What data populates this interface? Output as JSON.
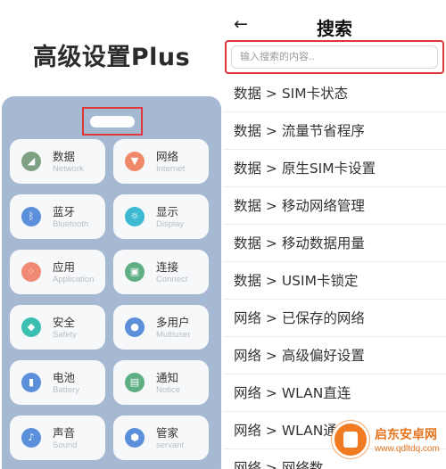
{
  "left": {
    "title": "高级设置Plus",
    "tiles": [
      {
        "name": "数据",
        "sub": "Network",
        "icon": "signal-icon",
        "glyph": "◢",
        "color": "#7ea183"
      },
      {
        "name": "网络",
        "sub": "Internet",
        "icon": "wifi-icon",
        "glyph": "▼",
        "color": "#f0896a"
      },
      {
        "name": "蓝牙",
        "sub": "Bluetooth",
        "icon": "bluetooth-icon",
        "glyph": "ᛒ",
        "color": "#5b8fd9"
      },
      {
        "name": "显示",
        "sub": "Display",
        "icon": "display-icon",
        "glyph": "☼",
        "color": "#3dbad2"
      },
      {
        "name": "应用",
        "sub": "Application",
        "icon": "apps-icon",
        "glyph": "⁘",
        "color": "#f08a74"
      },
      {
        "name": "连接",
        "sub": "Connect",
        "icon": "connect-icon",
        "glyph": "▣",
        "color": "#5fae84"
      },
      {
        "name": "安全",
        "sub": "Safety",
        "icon": "shield-icon",
        "glyph": "◆",
        "color": "#3bbfb0"
      },
      {
        "name": "多用户",
        "sub": "Multiuser",
        "icon": "user-icon",
        "glyph": "●",
        "color": "#5b8fd9"
      },
      {
        "name": "电池",
        "sub": "Battery",
        "icon": "battery-icon",
        "glyph": "▮",
        "color": "#5b8fd9"
      },
      {
        "name": "通知",
        "sub": "Notice",
        "icon": "notice-icon",
        "glyph": "▤",
        "color": "#5fae84"
      },
      {
        "name": "声音",
        "sub": "Sound",
        "icon": "mic-icon",
        "glyph": "♪",
        "color": "#5b8fd9"
      },
      {
        "name": "管家",
        "sub": "servant",
        "icon": "box-icon",
        "glyph": "⬢",
        "color": "#5b8fd9"
      }
    ]
  },
  "right": {
    "back_icon": "←",
    "title": "搜索",
    "search_placeholder": "输入搜索的内容..",
    "results": [
      "数据 > SIM卡状态",
      "数据 > 流量节省程序",
      "数据 > 原生SIM卡设置",
      "数据 > 移动网络管理",
      "数据 > 移动数据用量",
      "数据 > USIM卡锁定",
      "网络 > 已保存的网络",
      "网络 > 高级偏好设置",
      "网络 > WLAN直连",
      "网络 > WLAN通话",
      "网络 > 网络数"
    ]
  },
  "watermark": {
    "name": "启东安卓网",
    "url": "www.qdltdq.com"
  }
}
